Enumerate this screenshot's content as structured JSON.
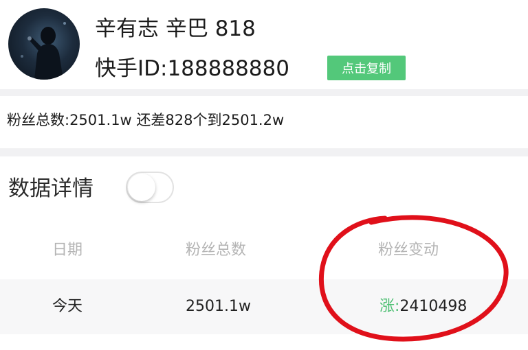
{
  "profile": {
    "name": "辛有志 辛巴 818",
    "id_text": "快手ID:188888880",
    "copy_button_label": "点击复制"
  },
  "fans_summary": "粉丝总数:2501.1w 还差828个到2501.2w",
  "details": {
    "title": "数据详情",
    "toggle_on": false
  },
  "table": {
    "headers": [
      "日期",
      "粉丝总数",
      "粉丝变动"
    ],
    "rows": [
      {
        "date": "今天",
        "total": "2501.1w",
        "change_label": "涨:",
        "change_value": "2410498"
      }
    ]
  },
  "colors": {
    "accent_green": "#53c87a",
    "annotation_red": "#e0101a"
  }
}
